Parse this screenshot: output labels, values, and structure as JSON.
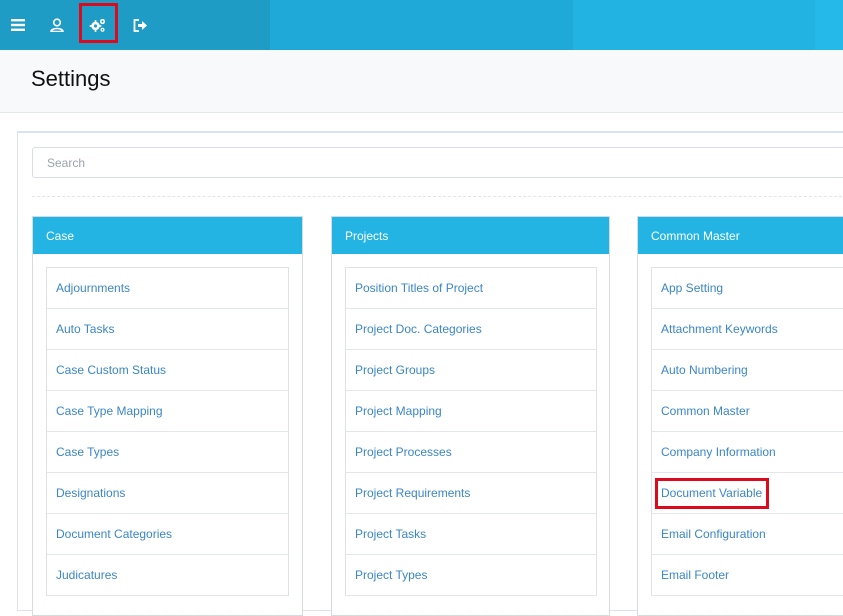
{
  "topbar": {
    "icons": [
      "menu-icon",
      "user-icon",
      "settings-gears-icon",
      "logout-icon"
    ],
    "accent": "#23b3e0"
  },
  "header": {
    "title": "Settings"
  },
  "search": {
    "placeholder": "Search",
    "value": ""
  },
  "cards": [
    {
      "title": "Case",
      "items": [
        "Adjournments",
        "Auto Tasks",
        "Case Custom Status",
        "Case Type Mapping",
        "Case Types",
        "Designations",
        "Document Categories",
        "Judicatures"
      ]
    },
    {
      "title": "Projects",
      "items": [
        "Position Titles of Project",
        "Project Doc. Categories",
        "Project Groups",
        "Project Mapping",
        "Project Processes",
        "Project Requirements",
        "Project Tasks",
        "Project Types"
      ]
    },
    {
      "title": "Common Master",
      "items": [
        "App Setting",
        "Attachment Keywords",
        "Auto Numbering",
        "Common Master",
        "Company Information",
        "Document Variable",
        "Email Configuration",
        "Email Footer"
      ]
    }
  ],
  "colors": {
    "card_header": "#23b4e3",
    "link": "#3a86c8",
    "highlight": "#dd0a1e"
  }
}
